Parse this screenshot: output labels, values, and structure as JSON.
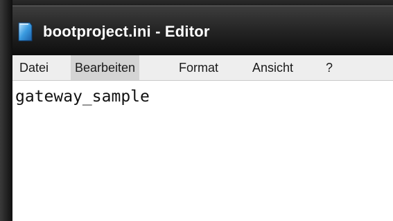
{
  "window": {
    "title": "bootproject.ini - Editor",
    "icon": "notepad-icon"
  },
  "menu": {
    "items": [
      "Datei",
      "Bearbeiten",
      "Format",
      "Ansicht",
      "?"
    ],
    "active": "Bearbeiten"
  },
  "editor": {
    "content": "gateway_sample"
  }
}
